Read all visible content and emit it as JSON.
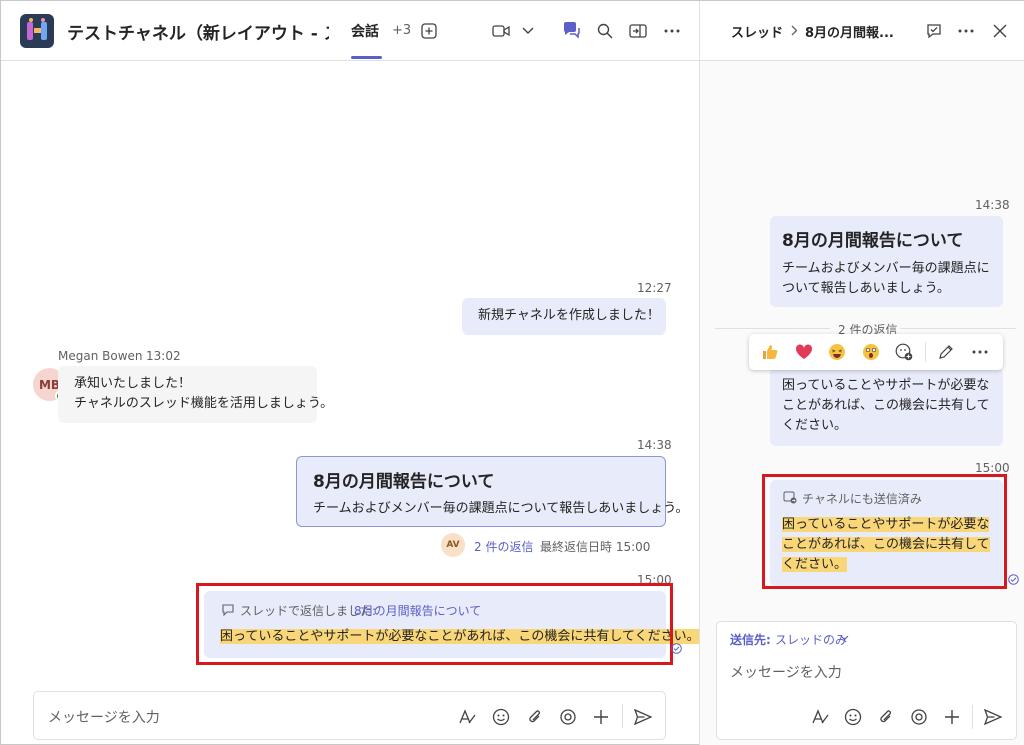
{
  "header": {
    "channel_title": "テストチャネル（新レイアウト - ス...",
    "tab_active": "会話",
    "tab_more": "+3"
  },
  "thread": {
    "breadcrumb_root": "スレッド",
    "breadcrumb_title": "8月の月間報...",
    "post_time": "14:38",
    "post_subject": "8月の月間報告について",
    "post_body": "チームおよびメンバー毎の課題点について報告しあいましょう。",
    "reply_count": "2 件の返信",
    "reply_preview": "困っていることやサポートが必要なことがあれば、この機会に共有してください。",
    "reply_time": "15:00",
    "also_sent_label": "チャネルにも送信済み",
    "reply_text": "困っていることやサポートが必要なことがあれば、この機会に共有してください。",
    "send_to_label": "送信先:",
    "send_to_value": "スレッドのみ",
    "compose_placeholder": "メッセージを入力",
    "reactions": [
      "thumbs-up",
      "heart",
      "laugh",
      "surprised",
      "add-reaction"
    ]
  },
  "conversation": {
    "msg1_time": "12:27",
    "msg1_text": "新規チャネルを作成しました！",
    "msg2_author": "Megan Bowen",
    "msg2_time": "13:02",
    "msg2_avatar": "MB",
    "msg2_line1": "承知いたしました！",
    "msg2_line2": "チャネルのスレッド機能を活用しましょう。",
    "msg3_time": "14:38",
    "msg3_subject": "8月の月間報告について",
    "msg3_body": "チームおよびメンバー毎の課題点について報告しあいましょう。",
    "msg3_avatar": "AV",
    "msg3_replies": "2 件の返信",
    "msg3_last_reply": "最終返信日時 15:00",
    "msg4_time": "15:00",
    "msg4_prefix": "スレッドで返信しました:",
    "msg4_link": "8月の月間報告について",
    "msg4_text": "困っていることやサポートが必要なことがあれば、この機会に共有してください。",
    "compose_placeholder": "メッセージを入力"
  },
  "colors": {
    "accent": "#5b5fc7",
    "bubble_me": "#e8ebfa",
    "highlight": "#f9d677",
    "annotation_red": "#d6191f"
  }
}
